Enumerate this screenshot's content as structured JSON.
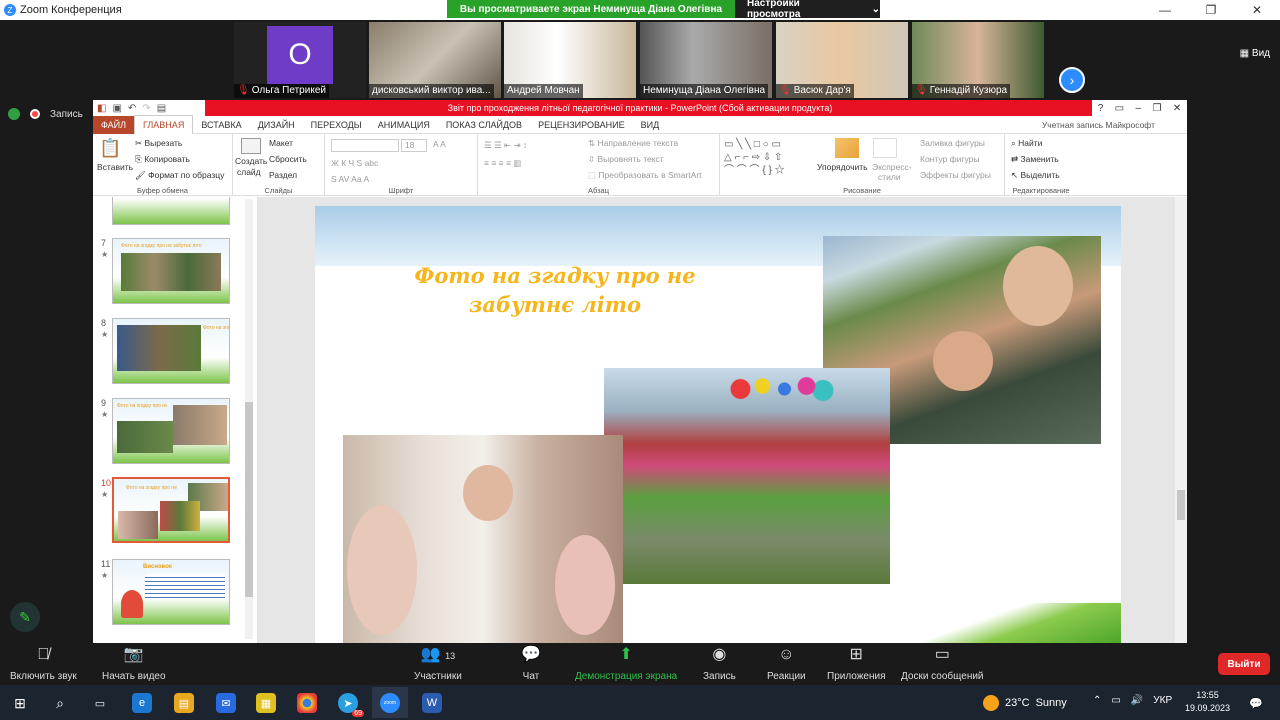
{
  "zoom": {
    "window_title": "Zoom Конференция",
    "share_banner": "Вы просматриваете экран Неминуща Діана Олегівна",
    "view_settings": "Настройки просмотра",
    "view_button": "Вид",
    "record_label": "Запись",
    "participants": [
      {
        "name": "Ольга Петрикей",
        "initial": "O",
        "muted": true
      },
      {
        "name": "дисковський виктор ива...",
        "muted": false
      },
      {
        "name": "Андрей Мовчан",
        "muted": false
      },
      {
        "name": "Неминуща Діана Олегівна",
        "muted": false
      },
      {
        "name": "Васюк Дар'я",
        "muted": true
      },
      {
        "name": "Геннадій Кузюра",
        "muted": true
      }
    ],
    "toolbar": {
      "audio": "Включить звук",
      "video": "Начать видео",
      "participants_count": "13",
      "participants": "Участники",
      "chat": "Чат",
      "share": "Демонстрация экрана",
      "record": "Запись",
      "reactions": "Реакции",
      "apps": "Приложения",
      "whiteboard": "Доски сообщений",
      "leave": "Выйти"
    }
  },
  "powerpoint": {
    "title": "Звіт про проходження літньої педагогічної  практики -  PowerPoint (Сбой активации продукта)",
    "tabs": [
      "ФАЙЛ",
      "ГЛАВНАЯ",
      "ВСТАВКА",
      "ДИЗАЙН",
      "ПЕРЕХОДЫ",
      "АНИМАЦИЯ",
      "ПОКАЗ СЛАЙДОВ",
      "РЕЦЕНЗИРОВАНИЕ",
      "ВИД"
    ],
    "account": "Учетная запись Майкрософт",
    "ribbon": {
      "paste": "Вставить",
      "cut": "Вырезать",
      "copy": "Копировать",
      "format_painter": "Формат по образцу",
      "clipboard_group": "Буфер обмена",
      "new_slide_1": "Создать",
      "new_slide_2": "слайд",
      "layout": "Макет",
      "reset": "Сбросить",
      "section": "Раздел",
      "slides_group": "Слайды",
      "font_size": "18",
      "font_group": "Шрифт",
      "text_direction": "Направление текста",
      "align_text": "Выровнять текст",
      "smartart": "Преобразовать в SmartArt",
      "paragraph_group": "Абзац",
      "arrange": "Упорядочить",
      "quick_styles_1": "Экспресс-",
      "quick_styles_2": "стили",
      "shape_fill": "Заливка фигуры",
      "shape_outline": "Контур фигуры",
      "shape_effects": "Эффекты фигуры",
      "drawing_group": "Рисование",
      "find": "Найти",
      "replace": "Заменить",
      "select": "Выделить",
      "editing_group": "Редактирование"
    },
    "thumbnails": [
      {
        "num": "7",
        "title": "Фото на згадку про не забутнє літо"
      },
      {
        "num": "8",
        "title": "Фото на згадку"
      },
      {
        "num": "9",
        "title": "Фото на згадку про не забутнє літо"
      },
      {
        "num": "10",
        "title": "Фото на згадку про не забутнє літо",
        "selected": true
      },
      {
        "num": "11",
        "title": "Висновок"
      }
    ],
    "slide": {
      "title_line1": "Фото на згадку про не",
      "title_line2": "забутнє літо"
    }
  },
  "taskbar": {
    "temperature": "23°C",
    "weather": "Sunny",
    "language": "УКР",
    "time": "13:55",
    "date": "19.09.2023",
    "telegram_badge": "69"
  }
}
